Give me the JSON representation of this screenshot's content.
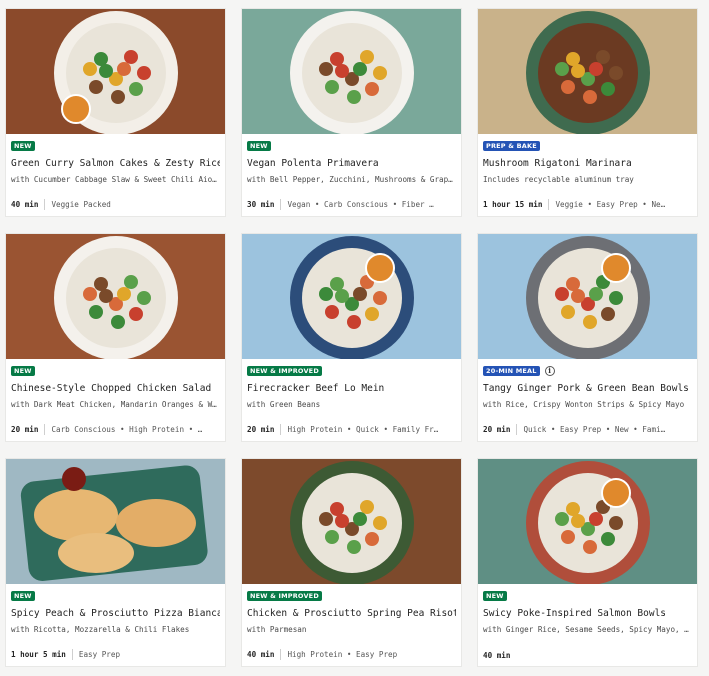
{
  "cards": [
    {
      "badge": "NEW",
      "badge_color": "#067a46",
      "title": "Green Curry Salmon Cakes & Zesty Rice",
      "subtitle": "with Cucumber Cabbage Slaw & Sweet Chili Aioli",
      "time": "40 min",
      "tags": "Veggie Packed",
      "bg": "#8b4a2b",
      "plate": "#f3efe8"
    },
    {
      "badge": "NEW",
      "badge_color": "#067a46",
      "title": "Vegan Polenta Primavera",
      "subtitle": "with Bell Pepper, Zucchini, Mushrooms & Grape Tom…",
      "time": "30 min",
      "tags": "Vegan • Carb Conscious • Fiber …",
      "bg": "#7aa89a",
      "plate": "#f4f2ee"
    },
    {
      "badge": "PREP & BAKE",
      "badge_color": "#2453b5",
      "title": "Mushroom Rigatoni Marinara",
      "subtitle": "Includes recyclable aluminum tray",
      "time": "1 hour 15 min",
      "tags": "Veggie • Easy Prep • Ne…",
      "bg": "#c9b28a",
      "plate": "#3f6b4f"
    },
    {
      "badge": "NEW",
      "badge_color": "#067a46",
      "title": "Chinese-Style Chopped Chicken Salad",
      "subtitle": "with Dark Meat Chicken, Mandarin Oranges & Wont…",
      "time": "20 min",
      "tags": "Carb Conscious • High Protein • …",
      "bg": "#9a5432",
      "plate": "#f4f1ec"
    },
    {
      "badge": "NEW & IMPROVED",
      "badge_color": "#067a46",
      "title": "Firecracker Beef Lo Mein",
      "subtitle": "with Green Beans",
      "time": "20 min",
      "tags": "High Protein • Quick • Family Fr…",
      "bg": "#9cc3de",
      "plate": "#2c4d7a"
    },
    {
      "badge": "20-MIN MEAL",
      "badge_color": "#2453b5",
      "title": "Tangy Ginger Pork & Green Bean Bowls",
      "subtitle": "with Rice, Crispy Wonton Strips & Spicy Mayo",
      "time": "20 min",
      "tags": "Quick • Easy Prep • New • Fami…",
      "bg": "#9cc3de",
      "plate": "#6d6f74"
    },
    {
      "badge": "NEW",
      "badge_color": "#067a46",
      "title": "Spicy Peach & Prosciutto Pizza Bianca",
      "subtitle": "with Ricotta, Mozzarella & Chili Flakes",
      "time": "1 hour 5 min",
      "tags": "Easy Prep",
      "bg": "#9fb8c3",
      "plate": "#2f6b5c"
    },
    {
      "badge": "NEW & IMPROVED",
      "badge_color": "#067a46",
      "title": "Chicken & Prosciutto Spring Pea Risotto",
      "subtitle": "with Parmesan",
      "time": "40 min",
      "tags": "High Protein • Easy Prep",
      "bg": "#7d4a2c",
      "plate": "#3d5a34"
    },
    {
      "badge": "NEW",
      "badge_color": "#067a46",
      "title": "Swicy Poke-Inspired Salmon Bowls",
      "subtitle": "with Ginger Rice, Sesame Seeds, Spicy Mayo, Pickle…",
      "time": "40 min",
      "tags": "",
      "bg": "#5f8f84",
      "plate": "#b04e3b"
    }
  ]
}
